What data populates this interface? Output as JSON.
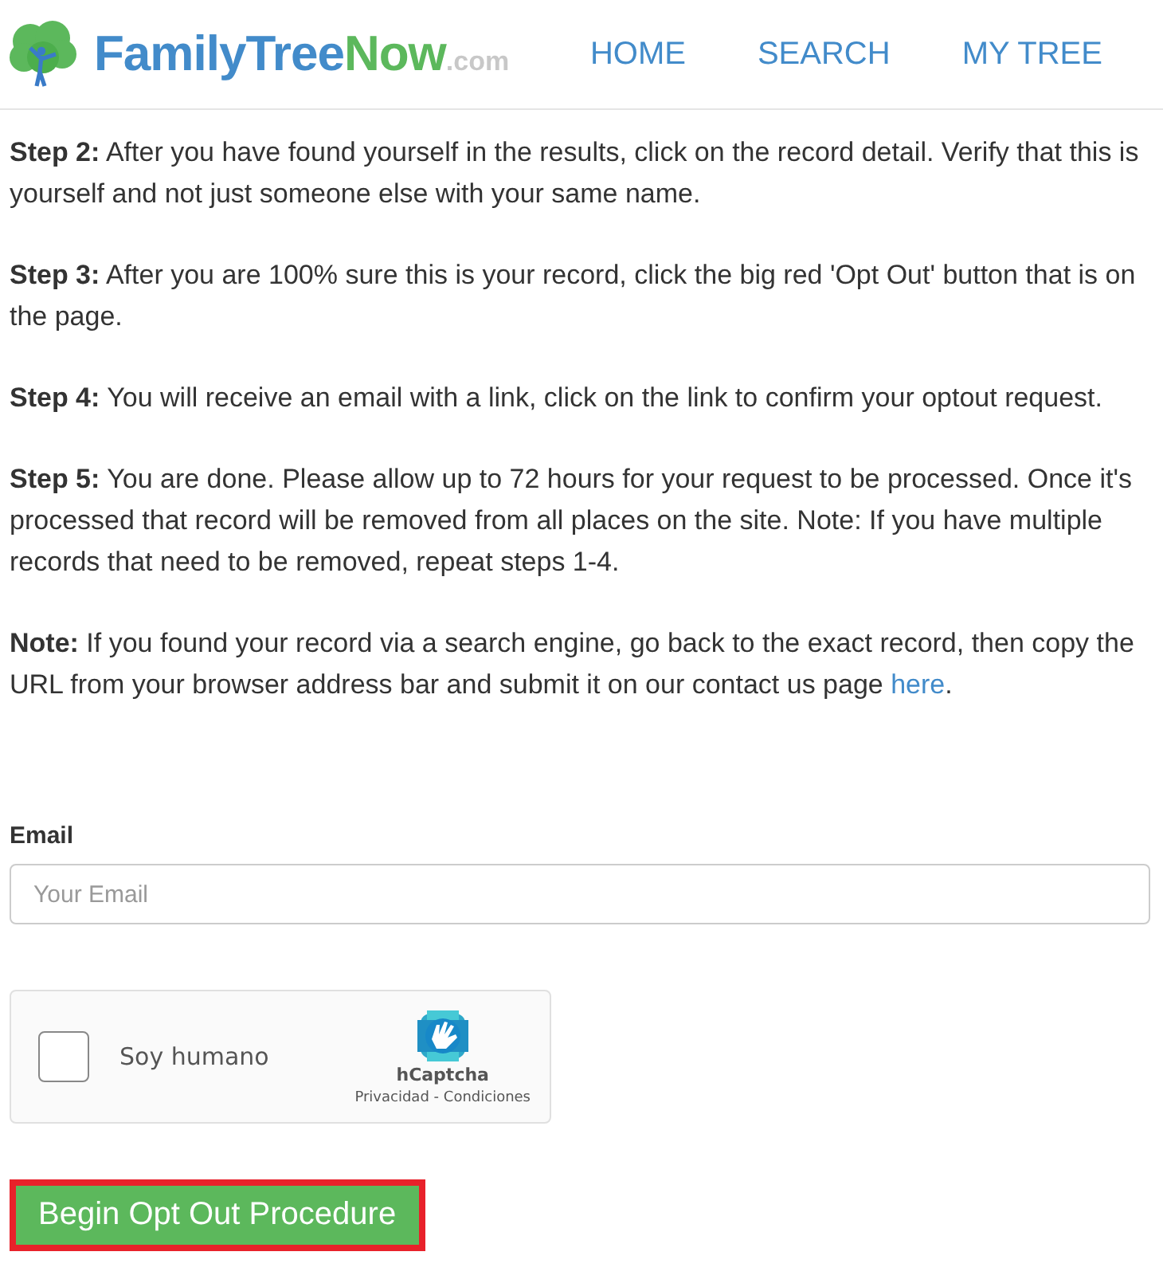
{
  "header": {
    "logo": {
      "name_main": "FamilyTree",
      "name_accent": "Now",
      "domain": ".com"
    },
    "nav": [
      {
        "label": "HOME"
      },
      {
        "label": "SEARCH"
      },
      {
        "label": "MY TREE"
      }
    ]
  },
  "steps": [
    {
      "text": "**Step 2:** After you have found yourself in the results, click on the record detail. Verify that this is yourself and not just someone else with your same name."
    },
    {
      "text": "**Step 3:** After you are 100% sure this is your record, click the big red 'Opt Out' button that is on the page."
    },
    {
      "text": "**Step 4:** You will receive an email with a link, click on the link to confirm your optout request."
    },
    {
      "text": "**Step 5:** You are done. Please allow up to 72 hours for your request to be processed. Once it's processed that record will be removed from all places on the site. Note: If you have multiple records that need to be removed, repeat steps 1-4."
    },
    {
      "text": "**Note:** If you found your record via a search engine, go back to the exact record, then copy the URL from your browser address bar and submit it on our contact us page ",
      "link": "here",
      "after": "."
    }
  ],
  "form": {
    "email_label": "Email",
    "email_placeholder": "Your Email",
    "captcha": {
      "label": "Soy humano",
      "checked": false,
      "brand": "hCaptcha",
      "privacy": "Privacidad",
      "separator": "-",
      "terms": "Condiciones"
    },
    "submit": {
      "label": "Begin Opt Out Procedure",
      "highlighted": true
    }
  }
}
